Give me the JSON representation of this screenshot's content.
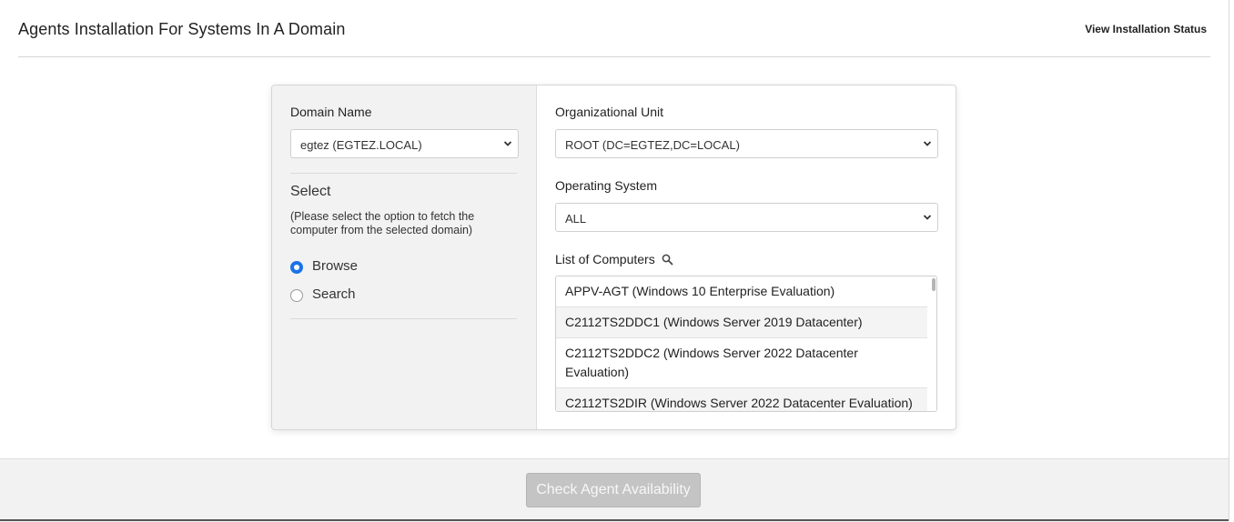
{
  "header": {
    "title": "Agents Installation For Systems In A Domain",
    "status_link": "View Installation Status"
  },
  "left": {
    "domain_label": "Domain Name",
    "domain_value": "egtez (EGTEZ.LOCAL)",
    "select_heading": "Select",
    "help_text": "(Please select the option to fetch the computer from the selected domain)",
    "options": [
      {
        "label": "Browse",
        "checked": true
      },
      {
        "label": "Search",
        "checked": false
      }
    ]
  },
  "right": {
    "ou_label": "Organizational Unit",
    "ou_value": "ROOT (DC=EGTEZ,DC=LOCAL)",
    "os_label": "Operating System",
    "os_value": "ALL",
    "computers_label": "List of Computers",
    "computers": [
      "APPV-AGT (Windows 10 Enterprise Evaluation)",
      "C2112TS2DDC1 (Windows Server 2019 Datacenter)",
      "C2112TS2DDC2 (Windows Server 2022 Datacenter Evaluation)",
      "C2112TS2DIR (Windows Server 2022 Datacenter Evaluation)"
    ]
  },
  "footer": {
    "check_button": "Check Agent Availability"
  }
}
